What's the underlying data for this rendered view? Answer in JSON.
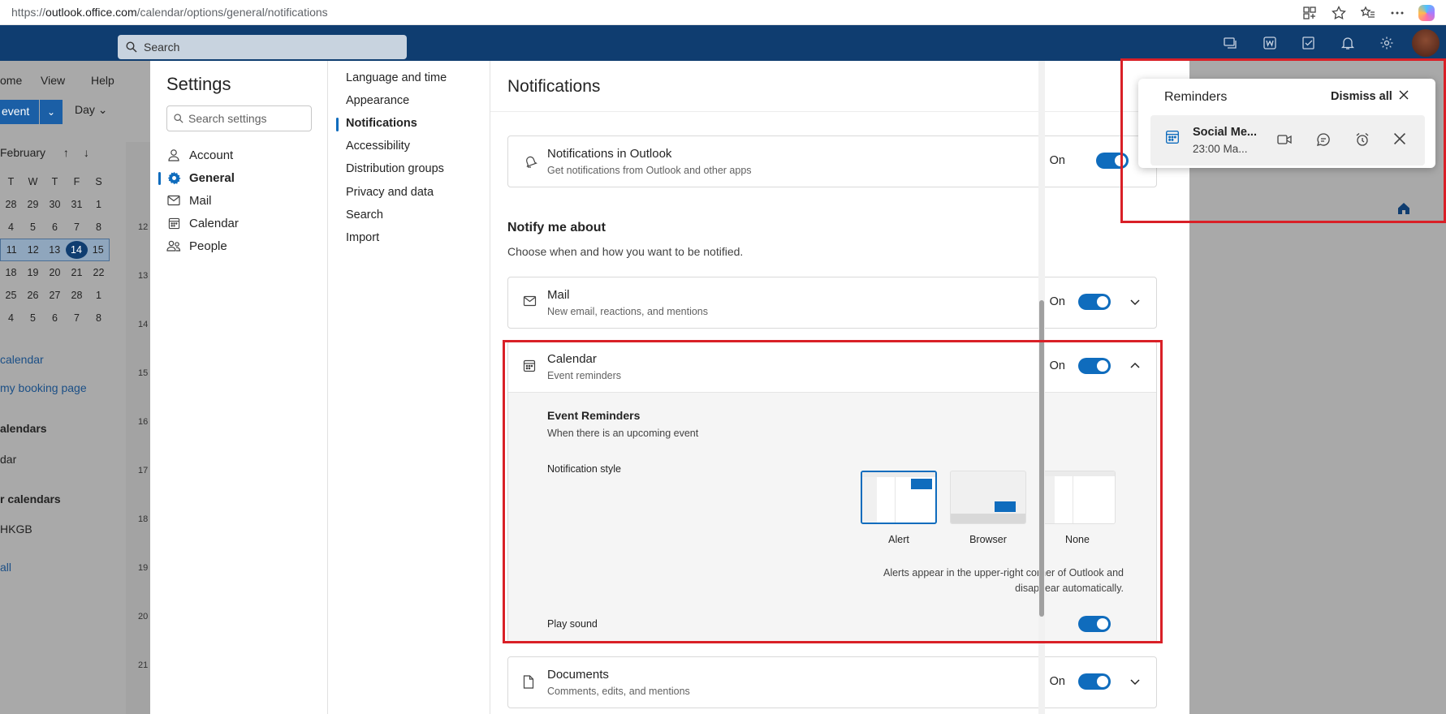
{
  "browser": {
    "url_prefix": "https://",
    "url_host": "outlook.office.com",
    "url_path": "/calendar/options/general/notifications"
  },
  "outlook": {
    "search_placeholder": "Search",
    "tabs": [
      "ome",
      "View",
      "Help"
    ],
    "new_event_label": "event",
    "view_label": "Day",
    "month_label": "February",
    "weekdays": [
      "T",
      "W",
      "T",
      "F",
      "S"
    ],
    "weeks": [
      [
        "28",
        "29",
        "30",
        "31",
        "1"
      ],
      [
        "4",
        "5",
        "6",
        "7",
        "8"
      ],
      [
        "11",
        "12",
        "13",
        "14",
        "15"
      ],
      [
        "18",
        "19",
        "20",
        "21",
        "22"
      ],
      [
        "25",
        "26",
        "27",
        "28",
        "1"
      ],
      [
        "4",
        "5",
        "6",
        "7",
        "8"
      ]
    ],
    "links": [
      "calendar",
      " my booking page"
    ],
    "group_labels": [
      "alendars",
      "dar",
      "r calendars",
      "HKGB"
    ],
    "show_all": " all",
    "hours": [
      "12",
      "13",
      "14",
      "15",
      "16",
      "17",
      "18",
      "19",
      "20",
      "21"
    ]
  },
  "settings": {
    "title": "Settings",
    "search_placeholder": "Search settings",
    "nav": [
      {
        "label": "Account",
        "icon": "person-icon"
      },
      {
        "label": "General",
        "icon": "gear-icon"
      },
      {
        "label": "Mail",
        "icon": "mail-icon"
      },
      {
        "label": "Calendar",
        "icon": "calendar-icon"
      },
      {
        "label": "People",
        "icon": "people-icon"
      }
    ],
    "sub_nav": [
      "Language and time",
      "Appearance",
      "Notifications",
      "Accessibility",
      "Distribution groups",
      "Privacy and data",
      "Search",
      "Import"
    ],
    "active_sub": "Notifications"
  },
  "notifications": {
    "title": "Notifications",
    "outlook_card": {
      "title": "Notifications in Outlook",
      "subtitle": "Get notifications from Outlook and other apps",
      "state": "On"
    },
    "notify_heading": "Notify me about",
    "notify_sub": "Choose when and how you want to be notified.",
    "mail_card": {
      "title": "Mail",
      "subtitle": "New email, reactions, and mentions",
      "state": "On"
    },
    "calendar_card": {
      "title": "Calendar",
      "subtitle": "Event reminders",
      "state": "On",
      "event_reminders_title": "Event Reminders",
      "event_reminders_sub": "When there is an upcoming event",
      "notification_style_label": "Notification style",
      "styles": [
        "Alert",
        "Browser",
        "None"
      ],
      "selected_style": "Alert",
      "alert_note": "Alerts appear in the upper-right corner of Outlook and disappear automatically.",
      "play_sound_label": "Play sound",
      "play_sound": true
    },
    "documents_card": {
      "title": "Documents",
      "subtitle": "Comments, edits, and mentions",
      "state": "On"
    }
  },
  "reminders": {
    "title": "Reminders",
    "dismiss_all": "Dismiss all",
    "item_title": "Social Me...",
    "item_sub": "23:00  Ma..."
  },
  "colors": {
    "brand": "#0f3d70",
    "accent": "#0f6cbd",
    "highlight": "#d92027"
  }
}
